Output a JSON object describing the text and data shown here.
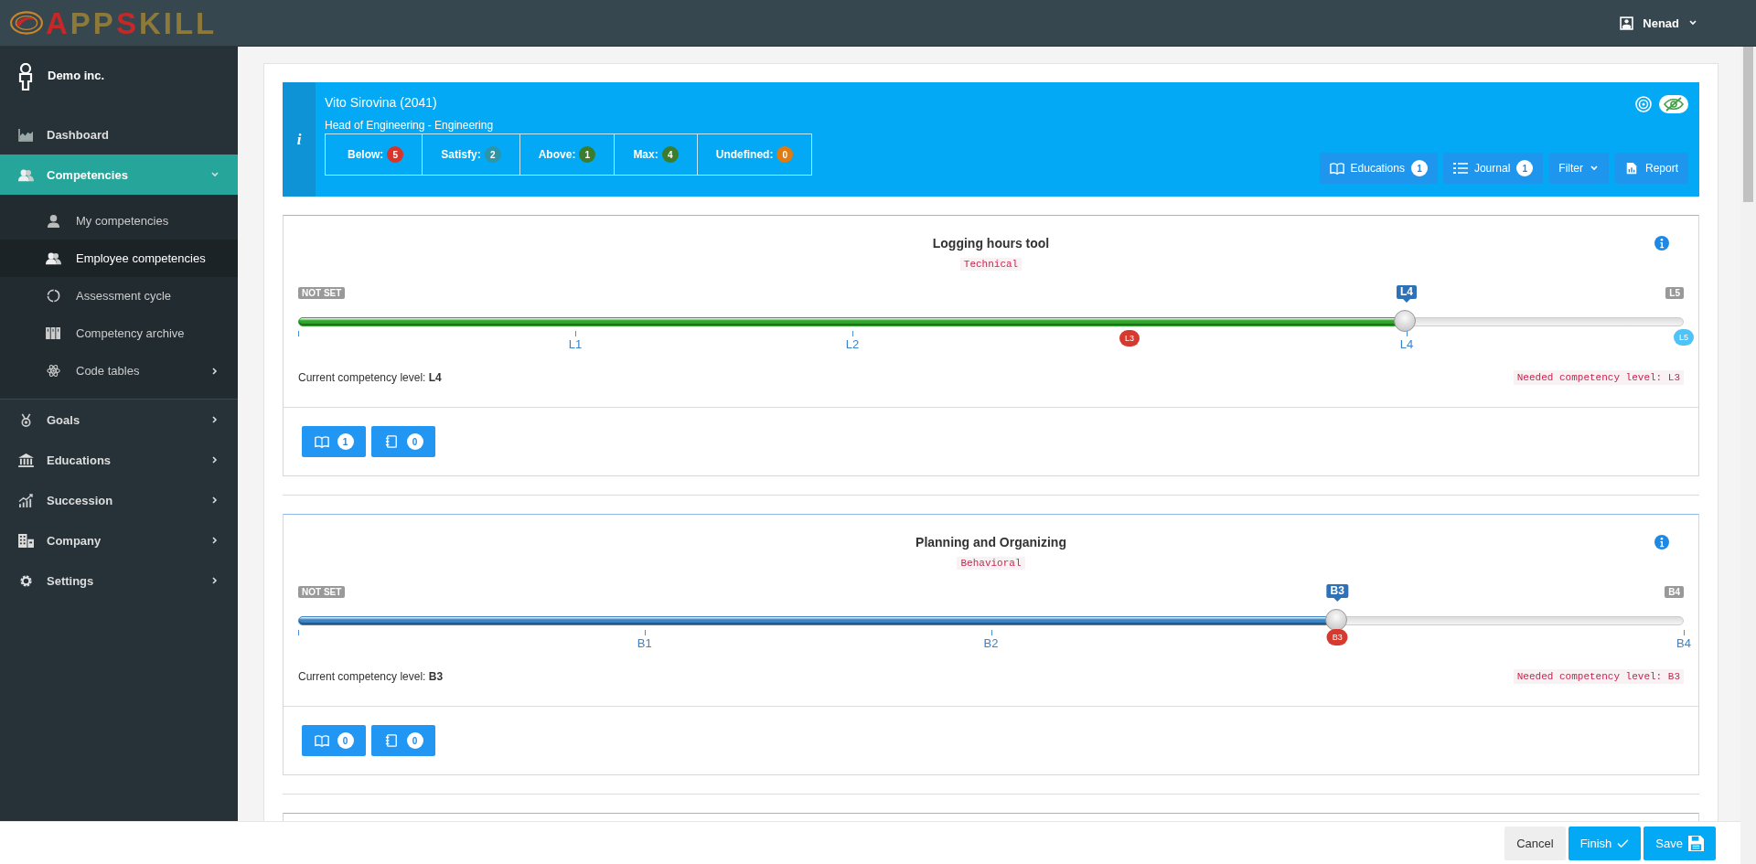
{
  "logo": {
    "parts": [
      {
        "text": "A",
        "color": "#c62828"
      },
      {
        "text": "PP",
        "color": "#8d7a3a"
      },
      {
        "text": "S",
        "color": "#c62828"
      },
      {
        "text": "KILL",
        "color": "#8d7a3a"
      }
    ]
  },
  "user_menu": {
    "name": "Nenad"
  },
  "sidebar": {
    "company": "Demo inc.",
    "items": [
      {
        "label": "Dashboard",
        "kind": "link",
        "selected": false
      },
      {
        "label": "Competencies",
        "kind": "menu",
        "selected": true,
        "expanded": true,
        "children": [
          {
            "label": "My competencies",
            "kind": "link",
            "selected": false
          },
          {
            "label": "Employee competencies",
            "kind": "link",
            "selected": true
          },
          {
            "label": "Assessment cycle",
            "kind": "link",
            "selected": false
          },
          {
            "label": "Competency archive",
            "kind": "link",
            "selected": false
          },
          {
            "label": "Code tables",
            "kind": "menu",
            "selected": false,
            "expanded": false
          }
        ]
      },
      {
        "label": "Goals",
        "kind": "menu",
        "selected": false,
        "expanded": false
      },
      {
        "label": "Educations",
        "kind": "menu",
        "selected": false,
        "expanded": false
      },
      {
        "label": "Succession",
        "kind": "menu",
        "selected": false,
        "expanded": false
      },
      {
        "label": "Company",
        "kind": "menu",
        "selected": false,
        "expanded": false
      },
      {
        "label": "Settings",
        "kind": "menu",
        "selected": false,
        "expanded": false
      }
    ]
  },
  "employee": {
    "info_mark": "i",
    "name": "Vito Sirovina (2041)",
    "position": "Head of Engineering - Engineering",
    "stats": [
      {
        "label": "Below:",
        "count": "5",
        "color": "#d9342b"
      },
      {
        "label": "Satisfy:",
        "count": "2",
        "color": "#2e94a8"
      },
      {
        "label": "Above:",
        "count": "1",
        "color": "#3b7d2a"
      },
      {
        "label": "Max:",
        "count": "4",
        "color": "#3b7d2a"
      },
      {
        "label": "Undefined:",
        "count": "0",
        "color": "#e07b12"
      }
    ],
    "buttons": [
      {
        "kind": "educations",
        "label": "Educations",
        "count": "1"
      },
      {
        "kind": "journal",
        "label": "Journal",
        "count": "1"
      },
      {
        "kind": "filter",
        "label": "Filter"
      },
      {
        "kind": "report",
        "label": "Report"
      }
    ]
  },
  "competencies": [
    {
      "title": "Logging hours tool",
      "category": "Technical",
      "min_label": "NOT SET",
      "max_label": "L5",
      "current_bubble": "L4",
      "level": 0.8,
      "color": "#2fa82a",
      "ticks": [
        {
          "label": "L1",
          "kind": "plain"
        },
        {
          "label": "L2",
          "kind": "plain"
        },
        {
          "label": "L3",
          "kind": "needed"
        },
        {
          "label": "L4",
          "kind": "plain"
        },
        {
          "label": "L5",
          "kind": "top"
        }
      ],
      "current_label": "Current competency level:",
      "current_value": "L4",
      "needed": "Needed competency level: L3",
      "educations_count": "1",
      "journal_count": "0"
    },
    {
      "title": "Planning and Organizing",
      "category": "Behavioral",
      "min_label": "NOT SET",
      "max_label": "B4",
      "current_bubble": "B3",
      "level": 0.75,
      "color": "#3d85c6",
      "ticks": [
        {
          "label": "B1",
          "kind": "plain"
        },
        {
          "label": "B2",
          "kind": "plain"
        },
        {
          "label": "B3",
          "kind": "needed"
        },
        {
          "label": "B4",
          "kind": "plain"
        }
      ],
      "current_label": "Current competency level:",
      "current_value": "B3",
      "needed": "Needed competency level: B3",
      "educations_count": "0",
      "journal_count": "0"
    }
  ],
  "footer": {
    "buttons": [
      {
        "kind": "cancel",
        "label": "Cancel"
      },
      {
        "kind": "finish",
        "label": "Finish"
      },
      {
        "kind": "save",
        "label": "Save"
      }
    ]
  }
}
